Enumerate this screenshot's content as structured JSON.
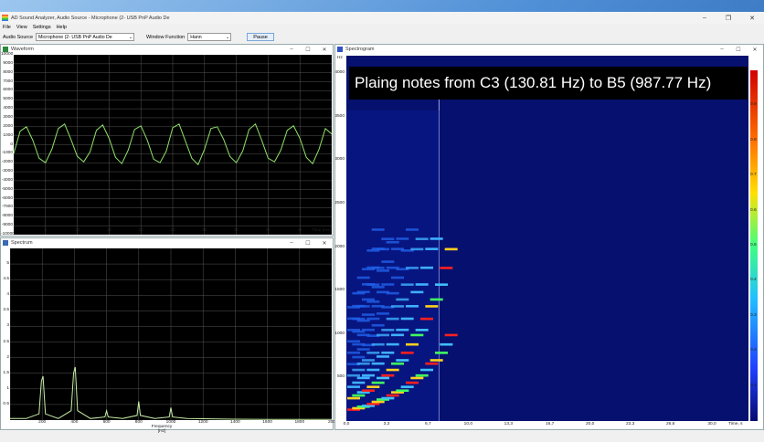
{
  "app": {
    "title": "AD Sound Analyzer, Audio Source - Microphone (2- USB PnP Audio De",
    "menu": [
      "File",
      "View",
      "Settings",
      "Help"
    ],
    "toolbar": {
      "audio_source_label": "Audio Source",
      "audio_source_value": "Microphone (2- USB PnP Audio De",
      "window_function_label": "Window Function",
      "window_function_value": "Hann",
      "pause_label": "Pause"
    }
  },
  "waveform": {
    "title": "Waveform",
    "y_ticks": [
      "10000",
      "9000",
      "8000",
      "7000",
      "6000",
      "5000",
      "4000",
      "3000",
      "2000",
      "1000",
      "0",
      "-1000",
      "-2000",
      "-3000",
      "-4000",
      "-5000",
      "-6000",
      "-7000",
      "-8000",
      "-9000",
      "-10000"
    ],
    "x_ticks": [
      "5",
      "10",
      "15",
      "20",
      "25",
      "30",
      "35",
      "40",
      "45"
    ],
    "x_label": "Time [ms]"
  },
  "spectrum": {
    "title": "Spectrum",
    "y_ticks": [
      "5",
      "4.5",
      "4",
      "3.5",
      "3",
      "2.5",
      "2",
      "1.5",
      "1",
      "0.5"
    ],
    "x_ticks": [
      "200",
      "400",
      "600",
      "800",
      "1000",
      "1200",
      "1400",
      "1600",
      "1800",
      "200"
    ],
    "x_label": "Frequency [Hz]"
  },
  "spectrogram": {
    "title": "Spectrogram",
    "y_unit": "Hz",
    "y_ticks": [
      "4000",
      "3500",
      "3000",
      "2500",
      "2000",
      "1500",
      "1000",
      "500"
    ],
    "x_ticks": [
      "0,0",
      "3,3",
      "6,7",
      "10,0",
      "13,3",
      "16,7",
      "20,0",
      "23,3",
      "26,6",
      "30,0"
    ],
    "x_label": "Time, s",
    "colorbar_ticks": [
      "0.9",
      "0.8",
      "0.7",
      "0.6",
      "0.5",
      "0.4",
      "0.3",
      "0.2",
      "0.1"
    ],
    "overlay_text": "Plaing notes from C3 (130.81 Hz) to B5 (987.77 Hz)"
  },
  "colors": {
    "waveform_line": "#8ee06a",
    "spectrum_line": "#c8f0a8",
    "spectrogram_bg": "#06106e",
    "accent": "#2060c0"
  },
  "chart_data": [
    {
      "type": "line",
      "title": "",
      "xlabel": "Time [ms]",
      "ylabel": "",
      "xlim": [
        0,
        50
      ],
      "ylim": [
        -10000,
        10000
      ],
      "grid": true,
      "series": [
        {
          "name": "",
          "x": [
            0,
            1,
            2,
            3,
            4,
            5,
            6,
            7,
            8,
            9,
            10,
            11,
            12,
            13,
            14,
            15,
            16,
            17,
            18,
            19,
            20,
            21,
            22,
            23,
            24,
            25,
            26,
            27,
            28,
            29,
            30,
            31,
            32,
            33,
            34,
            35,
            36,
            37,
            38,
            39,
            40,
            41,
            42,
            43,
            44,
            45,
            46,
            47,
            48,
            49,
            50
          ],
          "y": [
            -1000,
            1500,
            2000,
            500,
            -1500,
            -2000,
            -500,
            1800,
            2300,
            600,
            -1300,
            -1900,
            -800,
            1600,
            2200,
            700,
            -1400,
            -2100,
            -600,
            1700,
            2100,
            500,
            -1600,
            -2000,
            -700,
            1900,
            2300,
            400,
            -1500,
            -2200,
            -500,
            1800,
            2000,
            600,
            -1300,
            -2000,
            -700,
            1700,
            2300,
            500,
            -1500,
            -1900,
            -600,
            1600,
            2100,
            700,
            -1400,
            -2100,
            -500,
            1800,
            1200
          ]
        }
      ]
    },
    {
      "type": "line",
      "title": "",
      "xlabel": "Frequency [Hz]",
      "ylabel": "",
      "xlim": [
        0,
        2000
      ],
      "ylim": [
        0,
        5.5
      ],
      "grid": true,
      "series": [
        {
          "name": "",
          "x": [
            0,
            100,
            180,
            195,
            205,
            220,
            300,
            380,
            395,
            405,
            420,
            500,
            590,
            600,
            610,
            700,
            790,
            800,
            810,
            900,
            990,
            1000,
            1010,
            1100,
            1400,
            1600,
            1800,
            2000
          ],
          "y": [
            0.05,
            0.05,
            0.2,
            1.25,
            1.4,
            0.2,
            0.05,
            0.3,
            1.5,
            1.7,
            0.3,
            0.05,
            0.1,
            0.3,
            0.1,
            0.05,
            0.15,
            0.6,
            0.15,
            0.05,
            0.1,
            0.4,
            0.1,
            0.05,
            0.03,
            0.02,
            0.02,
            0.02
          ]
        }
      ]
    },
    {
      "type": "heatmap",
      "title": "",
      "xlabel": "Time, s",
      "ylabel": "Hz",
      "xlim": [
        0,
        33
      ],
      "ylim": [
        0,
        4200
      ],
      "notes": [
        {
          "t": 0.0,
          "f": 130.81
        },
        {
          "t": 0.4,
          "f": 146.83
        },
        {
          "t": 0.8,
          "f": 164.81
        },
        {
          "t": 1.2,
          "f": 174.61
        },
        {
          "t": 1.6,
          "f": 196.0
        },
        {
          "t": 2.0,
          "f": 220.0
        },
        {
          "t": 2.4,
          "f": 246.94
        },
        {
          "t": 2.8,
          "f": 261.63
        },
        {
          "t": 3.2,
          "f": 293.66
        },
        {
          "t": 3.6,
          "f": 329.63
        },
        {
          "t": 4.0,
          "f": 349.23
        },
        {
          "t": 4.4,
          "f": 392.0
        },
        {
          "t": 4.8,
          "f": 440.0
        },
        {
          "t": 5.2,
          "f": 493.88
        },
        {
          "t": 5.6,
          "f": 523.25
        },
        {
          "t": 6.0,
          "f": 587.33
        },
        {
          "t": 6.4,
          "f": 659.26
        },
        {
          "t": 6.8,
          "f": 698.46
        },
        {
          "t": 7.2,
          "f": 783.99
        },
        {
          "t": 7.6,
          "f": 880.0
        },
        {
          "t": 8.0,
          "f": 987.77
        }
      ]
    }
  ]
}
